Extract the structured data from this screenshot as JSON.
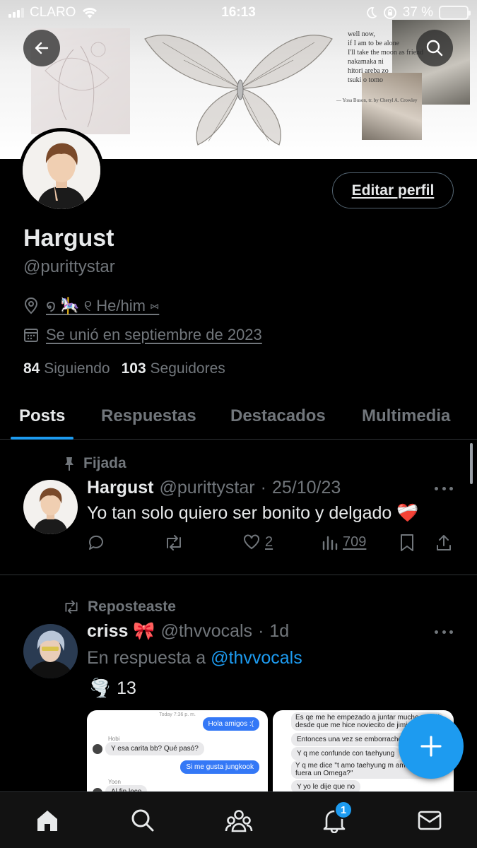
{
  "status_bar": {
    "carrier": "CLARO",
    "time": "16:13",
    "battery_percent": "37 %",
    "battery_level": 0.37,
    "icons": [
      "signal-icon",
      "wifi-icon",
      "moon-icon",
      "orientation-lock-icon",
      "battery-icon"
    ]
  },
  "banner": {
    "poem": "well now,\nif I am to be alone\nI'll take the moon as friend\nnakamaka ni\nhitori areba zo\ntsuki o tomo",
    "credit": "— Yosa Buson, tr. by Cheryl A. Crowley"
  },
  "profile": {
    "display_name": "Hargust",
    "handle": "@purittystar",
    "location": "໑ 🎠 ୧   He/him     ⑅",
    "joined": "Se unió en septiembre de 2023",
    "following_count": "84",
    "following_label": "Siguiendo",
    "followers_count": "103",
    "followers_label": "Seguidores",
    "edit_button": "Editar perfil"
  },
  "tabs": [
    {
      "label": "Posts",
      "active": true
    },
    {
      "label": "Respuestas",
      "active": false
    },
    {
      "label": "Destacados",
      "active": false
    },
    {
      "label": "Multimedia",
      "active": false
    }
  ],
  "posts": [
    {
      "context": "Fijada",
      "name": "Hargust",
      "handle": "@purittystar",
      "separator": "·",
      "date": "25/10/23",
      "text": "Yo tan solo quiero ser bonito y delgado ❤️‍🩹",
      "likes": "2",
      "views": "709"
    },
    {
      "context": "Reposteaste",
      "name": "criss 🎀",
      "handle": "@thvvocals",
      "separator": "·",
      "date": "1d",
      "reply_prefix": "En respuesta a",
      "reply_mention": "@thvvocals",
      "emoji_line_icon": "🌪️",
      "emoji_line_count": "13",
      "media": [
        {
          "header": "Today 7:36 p. m.",
          "messages": [
            {
              "from": "out",
              "text": "Hola amigos :("
            },
            {
              "from": "in",
              "sender": "Hobi",
              "text": "Y esa carita bb? Qué pasó?"
            },
            {
              "from": "out",
              "text": "Si me gusta jungkook"
            },
            {
              "from": "in",
              "sender": "Yoon",
              "text": "Al fin loco"
            }
          ]
        },
        {
          "messages": [
            {
              "from": "in",
              "text": "Es qe me he empezado a juntar mucho con él"
            },
            {
              "from": "in",
              "text": "desde que me hice noviecito de jimin"
            },
            {
              "from": "in",
              "text": "Entonces una vez se emborrachó"
            },
            {
              "from": "in",
              "text": "Y q me confunde con taehyung"
            },
            {
              "from": "in",
              "text": "Y q me dice \"t amo taehyung m amarías si"
            },
            {
              "from": "in",
              "text": "fuera un Omega?\""
            },
            {
              "from": "in",
              "text": "Y yo le dije que no"
            }
          ]
        }
      ]
    }
  ],
  "bottom_nav": {
    "items": [
      "home-icon",
      "search-icon",
      "communities-icon",
      "notifications-icon",
      "messages-icon"
    ],
    "notifications_badge": "1"
  },
  "colors": {
    "accent": "#1d9bf0",
    "background": "#000000",
    "text_primary": "#e7e9ea",
    "text_secondary": "#71767b",
    "divider": "#2f3336"
  }
}
